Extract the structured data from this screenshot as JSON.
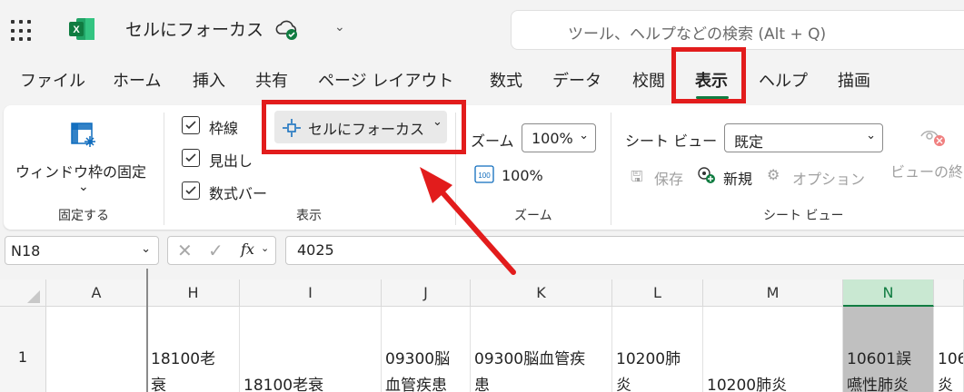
{
  "titlebar": {
    "doc_title": "セルにフォーカス",
    "search_placeholder": "ツール、ヘルプなどの検索 (Alt + Q)",
    "icons": [
      "waffle-icon",
      "excel-logo-icon",
      "cloud-saved-icon",
      "chevron-down-icon",
      "search-icon"
    ]
  },
  "tabs": [
    "ファイル",
    "ホーム",
    "挿入",
    "共有",
    "ページ レイアウト",
    "数式",
    "データ",
    "校閲",
    "表示",
    "ヘルプ",
    "描画"
  ],
  "active_tab": "表示",
  "ribbon": {
    "freeze": {
      "label": "ウィンドウ枠の固定",
      "chevron": "⌄",
      "group": "固定する"
    },
    "show": {
      "gridlines": "枠線",
      "headings": "見出し",
      "formula_bar": "数式バー",
      "focus_cell": "セルにフォーカス",
      "group": "表示"
    },
    "zoom": {
      "label": "ズーム",
      "value": "100%",
      "btn100": "100%",
      "group": "ズーム"
    },
    "sheetview": {
      "label": "シート ビュー",
      "value": "既定",
      "save": "保存",
      "new": "新規",
      "options": "オプション",
      "exit": "ビューの終",
      "group": "シート ビュー"
    }
  },
  "formula_bar": {
    "name_box": "N18",
    "value": "4025",
    "fx": "fx"
  },
  "grid": {
    "columns": [
      "A",
      "H",
      "I",
      "J",
      "K",
      "L",
      "M",
      "N",
      ""
    ],
    "selected_column": "N",
    "row_number": "1",
    "cells": [
      {
        "col": "A",
        "line1": "",
        "line2": ""
      },
      {
        "col": "H",
        "line1": "18100老",
        "line2": "衰"
      },
      {
        "col": "I",
        "line1": "",
        "line2": "18100老衰"
      },
      {
        "col": "J",
        "line1": "09300脳",
        "line2": "血管疾患"
      },
      {
        "col": "K",
        "line1": "09300脳血管疾",
        "line2": "患"
      },
      {
        "col": "L",
        "line1": "10200肺",
        "line2": "炎"
      },
      {
        "col": "M",
        "line1": "",
        "line2": "10200肺炎"
      },
      {
        "col": "N",
        "line1": "10601誤",
        "line2": "嚥性肺炎"
      },
      {
        "col": "",
        "line1": "106",
        "line2": "炎"
      }
    ]
  },
  "colors": {
    "accent": "#107c41",
    "highlight": "#e21c1c"
  }
}
